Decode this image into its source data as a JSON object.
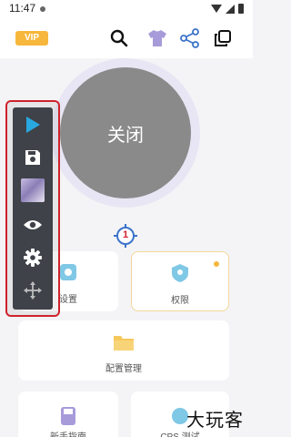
{
  "status": {
    "time": "11:47"
  },
  "topbar": {
    "vip_label": "VIP"
  },
  "power": {
    "label": "关闭"
  },
  "crosshair": {
    "number": "1"
  },
  "cards": {
    "settings": {
      "label": "设置"
    },
    "permissions": {
      "label": "权限"
    },
    "config": {
      "label": "配置管理"
    },
    "guide": {
      "label": "新手指南"
    },
    "cps": {
      "label": "CPS 测试"
    }
  },
  "floating_bar": {
    "items": [
      {
        "icon": "play-icon"
      },
      {
        "icon": "save-icon"
      },
      {
        "icon": "thumbnail-image"
      },
      {
        "icon": "eye-icon"
      },
      {
        "icon": "gear-icon"
      },
      {
        "icon": "move-icon"
      }
    ]
  },
  "colors": {
    "accent": "#3b73c9",
    "vip": "#f6b73c",
    "highlight_border": "#d0222b",
    "power_gray": "#8a8a8a"
  },
  "watermark": "大玩客"
}
